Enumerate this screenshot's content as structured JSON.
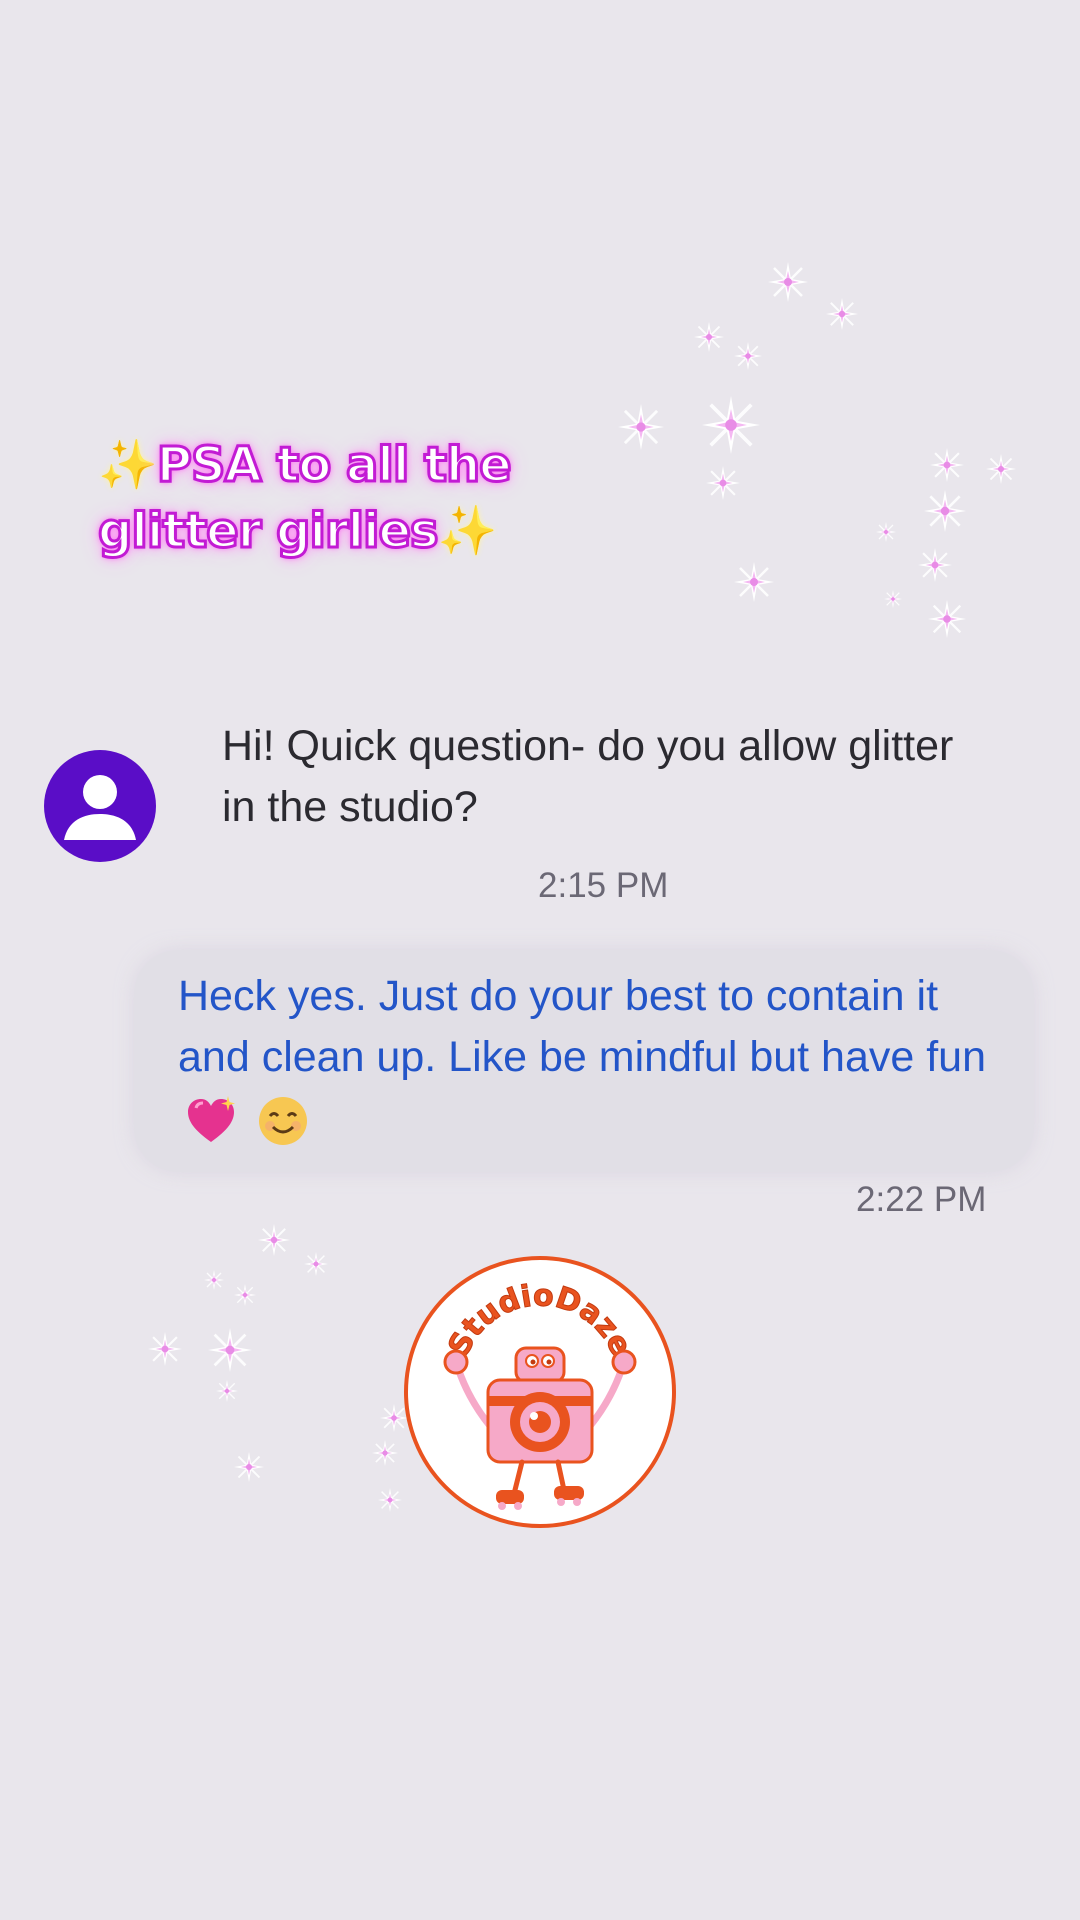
{
  "headline": {
    "star_left": "✨",
    "text": "PSA to all the glitter girlies",
    "star_right": "✨"
  },
  "avatar": {
    "icon": "person-icon"
  },
  "incoming_message": {
    "text": "Hi! Quick question- do you allow glitter in the studio?",
    "time": "2:15 PM"
  },
  "outgoing_message": {
    "text": "Heck yes. Just do your best to contain it and clean up. Like be mindful but have fun",
    "emojis": [
      "sparkling-heart-emoji",
      "smiling-face-emoji"
    ],
    "time": "2:22 PM"
  },
  "logo": {
    "text": "StudioDaze",
    "icon": "camera-mascot-logo"
  },
  "colors": {
    "background": "#e9e6ec",
    "headline_outline": "#c21bd4",
    "avatar": "#5a0dc7",
    "outgoing_text": "#2355c8",
    "logo_accent": "#e9531f",
    "logo_pink": "#f6a9c8"
  }
}
